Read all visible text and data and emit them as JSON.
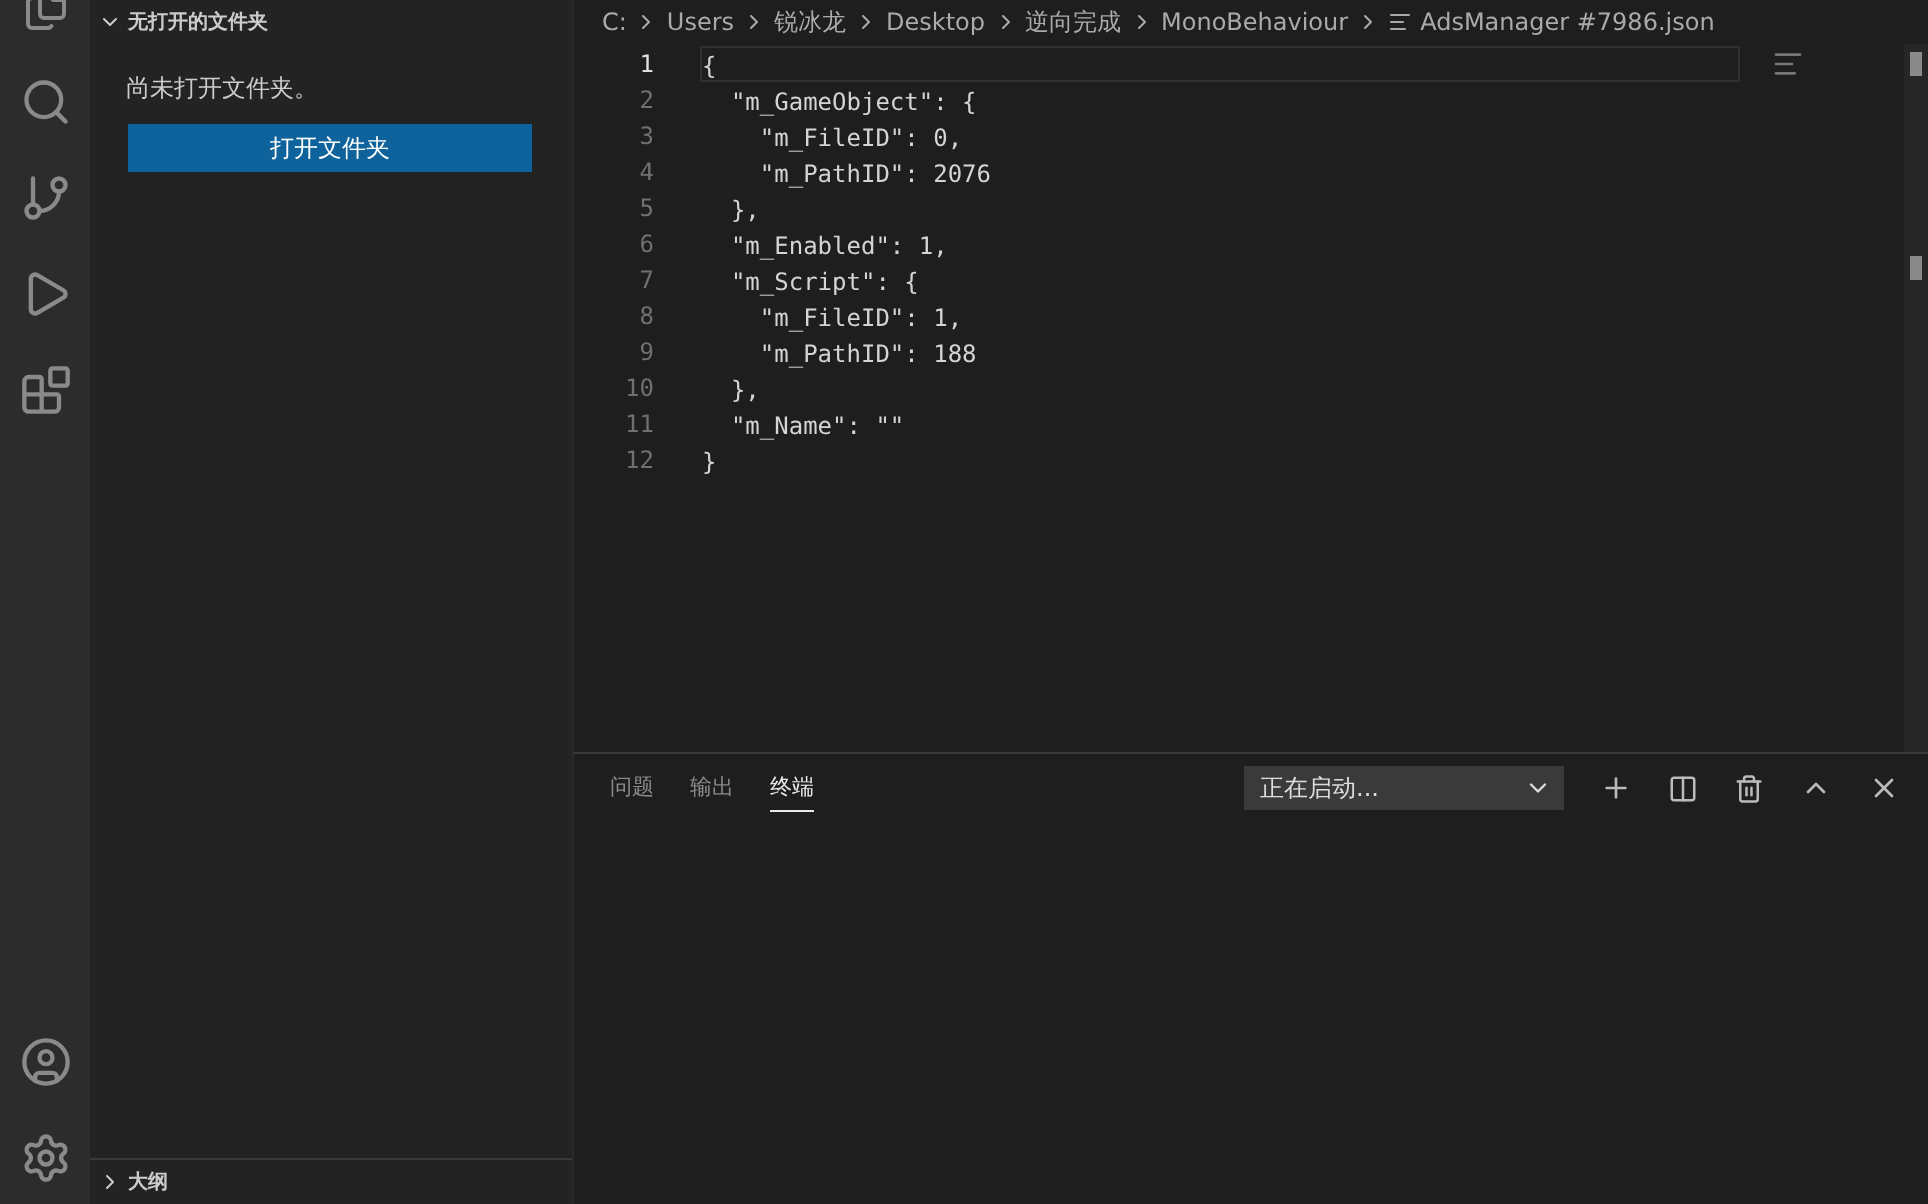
{
  "sidebar": {
    "sections": [
      {
        "title": "无打开的文件夹",
        "expanded": true,
        "message": "尚未打开文件夹。",
        "button": "打开文件夹"
      },
      {
        "title": "大纲",
        "expanded": false
      }
    ]
  },
  "breadcrumbs": [
    "C:",
    "Users",
    "锐冰龙",
    "Desktop",
    "逆向完成",
    "MonoBehaviour",
    "AdsManager #7986.json"
  ],
  "editor": {
    "lines": [
      {
        "number": "1",
        "text": "{",
        "current": true
      },
      {
        "number": "2",
        "text": "  \"m_GameObject\": {",
        "current": false
      },
      {
        "number": "3",
        "text": "    \"m_FileID\": 0,",
        "current": false
      },
      {
        "number": "4",
        "text": "    \"m_PathID\": 2076",
        "current": false
      },
      {
        "number": "5",
        "text": "  },",
        "current": false
      },
      {
        "number": "6",
        "text": "  \"m_Enabled\": 1,",
        "current": false
      },
      {
        "number": "7",
        "text": "  \"m_Script\": {",
        "current": false
      },
      {
        "number": "8",
        "text": "    \"m_FileID\": 1,",
        "current": false
      },
      {
        "number": "9",
        "text": "    \"m_PathID\": 188",
        "current": false
      },
      {
        "number": "10",
        "text": "  },",
        "current": false
      },
      {
        "number": "11",
        "text": "  \"m_Name\": \"\"",
        "current": false
      },
      {
        "number": "12",
        "text": "}",
        "current": false
      }
    ]
  },
  "panel": {
    "tabs": [
      {
        "label": "问题",
        "selected": false
      },
      {
        "label": "输出",
        "selected": false
      },
      {
        "label": "终端",
        "selected": true
      }
    ],
    "terminal_select": "正在启动..."
  }
}
